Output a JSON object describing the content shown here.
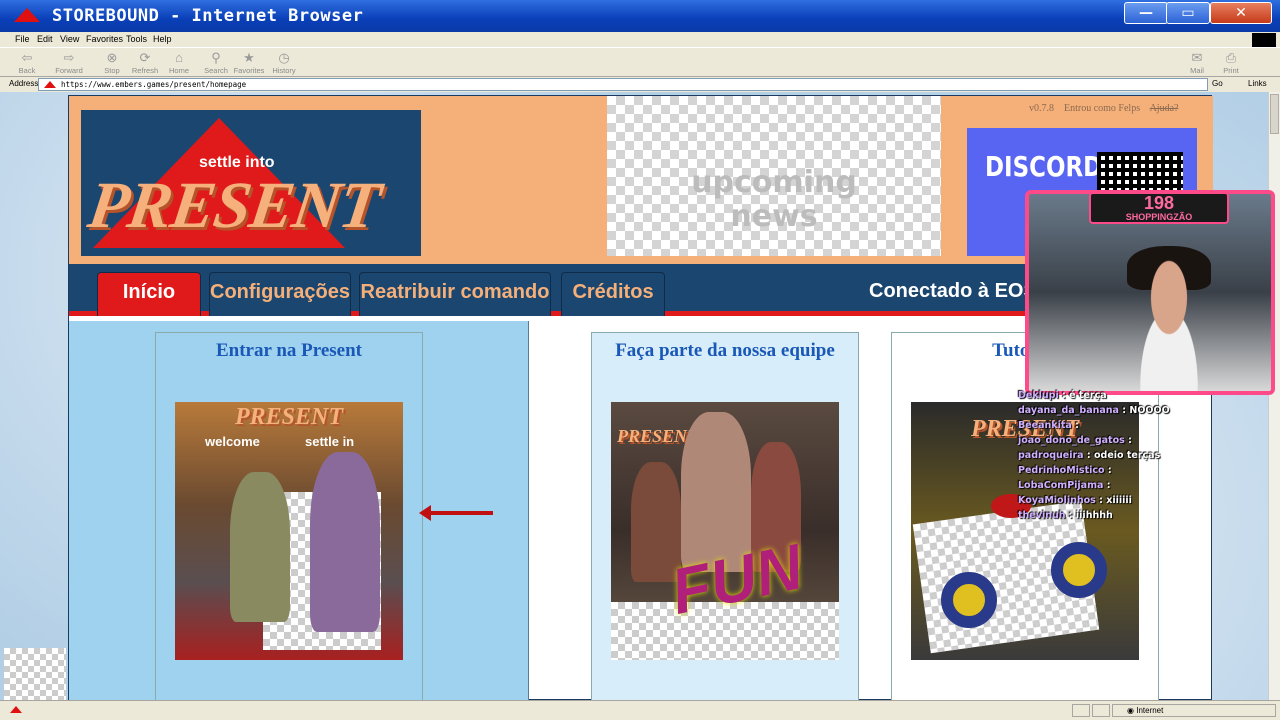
{
  "window": {
    "title": "STOREBOUND - Internet Browser",
    "min": "—",
    "max": "▭",
    "close": "✕"
  },
  "menu": [
    "File",
    "Edit",
    "View",
    "Favorites",
    "Tools",
    "Help"
  ],
  "toolbar": {
    "back": "Back",
    "forward": "Forward",
    "stop": "Stop",
    "refresh": "Refresh",
    "home": "Home",
    "search": "Search",
    "favorites": "Favorites",
    "history": "History",
    "mail": "Mail",
    "print": "Print"
  },
  "address": {
    "label": "Address",
    "url": "https://www.embers.games/present/homepage",
    "go": "Go",
    "links": "Links"
  },
  "header": {
    "logo_small": "settle into",
    "logo_big": "PRESENT",
    "news_line1": "upcoming",
    "news_line2": "news",
    "version": "v0.7.8",
    "logged_in": "Entrou como Felps",
    "help": "Ajuda?",
    "discord": "DISCORD"
  },
  "nav": {
    "tabs": [
      "Início",
      "Configurações",
      "Reatribuir comando",
      "Créditos"
    ],
    "connected": "Conectado à EOS"
  },
  "cards": [
    {
      "title": "Entrar na Present",
      "banner": "PRESENT",
      "sign1": "welcome",
      "sign2": "settle in"
    },
    {
      "title": "Faça parte da nossa equipe",
      "banner": "PRESENT",
      "fun": "FUN"
    },
    {
      "title": "Tutorial",
      "banner": "PRESENT"
    }
  ],
  "stream": {
    "count": "198",
    "badge": "SHOPPINGZÃO",
    "chat": [
      {
        "user": "Deklupi",
        "msg": "é terça"
      },
      {
        "user": "dayana_da_banana",
        "msg": "NOOOO"
      },
      {
        "user": "Beeankita",
        "msg": ""
      },
      {
        "user": "joao_dono_de_gatos",
        "msg": ""
      },
      {
        "user": "padroqueira",
        "msg": "odeio terças"
      },
      {
        "user": "PedrinhoMistico",
        "msg": ""
      },
      {
        "user": "LobaComPijama",
        "msg": ""
      },
      {
        "user": "KoyaMiolinhos",
        "msg": "xiiiiii"
      },
      {
        "user": "thevinuh",
        "msg": "iiihhhh"
      }
    ]
  },
  "status": {
    "zone": "Internet"
  },
  "colors": {
    "accent": "#e01a1a",
    "nav": "#1b4670",
    "header": "#f5b07a",
    "link": "#1a58b8"
  }
}
